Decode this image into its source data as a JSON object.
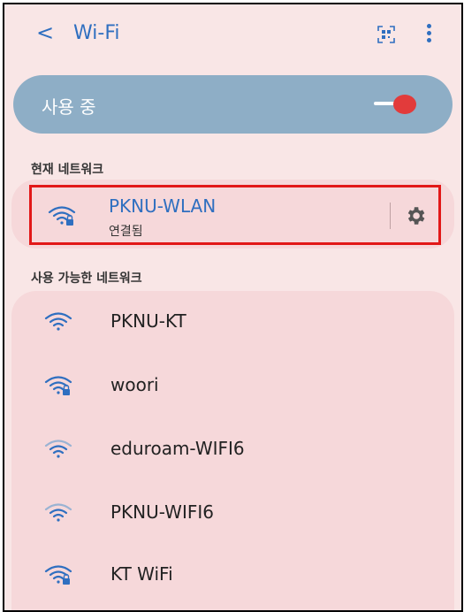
{
  "header": {
    "back_label": "<",
    "title": "Wi-Fi",
    "icons": [
      "qr-scan-icon",
      "more-options-icon"
    ]
  },
  "wifi_toggle": {
    "label": "사용 중",
    "state": "on",
    "thumb_color": "#e23b3b"
  },
  "current_network": {
    "section_label": "현재 네트워크",
    "name": "PKNU-WLAN",
    "status": "연결됨",
    "secured": true,
    "icons": [
      "wifi-lock-icon",
      "gear-icon"
    ]
  },
  "available_networks": {
    "section_label": "사용 가능한 네트워크",
    "items": [
      {
        "name": "PKNU-KT",
        "secured": false,
        "icon": "wifi-icon"
      },
      {
        "name": "woori",
        "secured": true,
        "icon": "wifi-lock-icon"
      },
      {
        "name": "eduroam-WIFI6",
        "secured": false,
        "icon": "wifi-icon"
      },
      {
        "name": "PKNU-WIFI6",
        "secured": false,
        "icon": "wifi-icon"
      },
      {
        "name": "KT WiFi",
        "secured": true,
        "icon": "wifi-lock-icon"
      }
    ]
  },
  "colors": {
    "accent": "#2f6fc0",
    "background": "#f9e6e6",
    "card": "#f6d8da",
    "toggle_card": "#8eaec6",
    "highlight_border": "#e21818"
  }
}
